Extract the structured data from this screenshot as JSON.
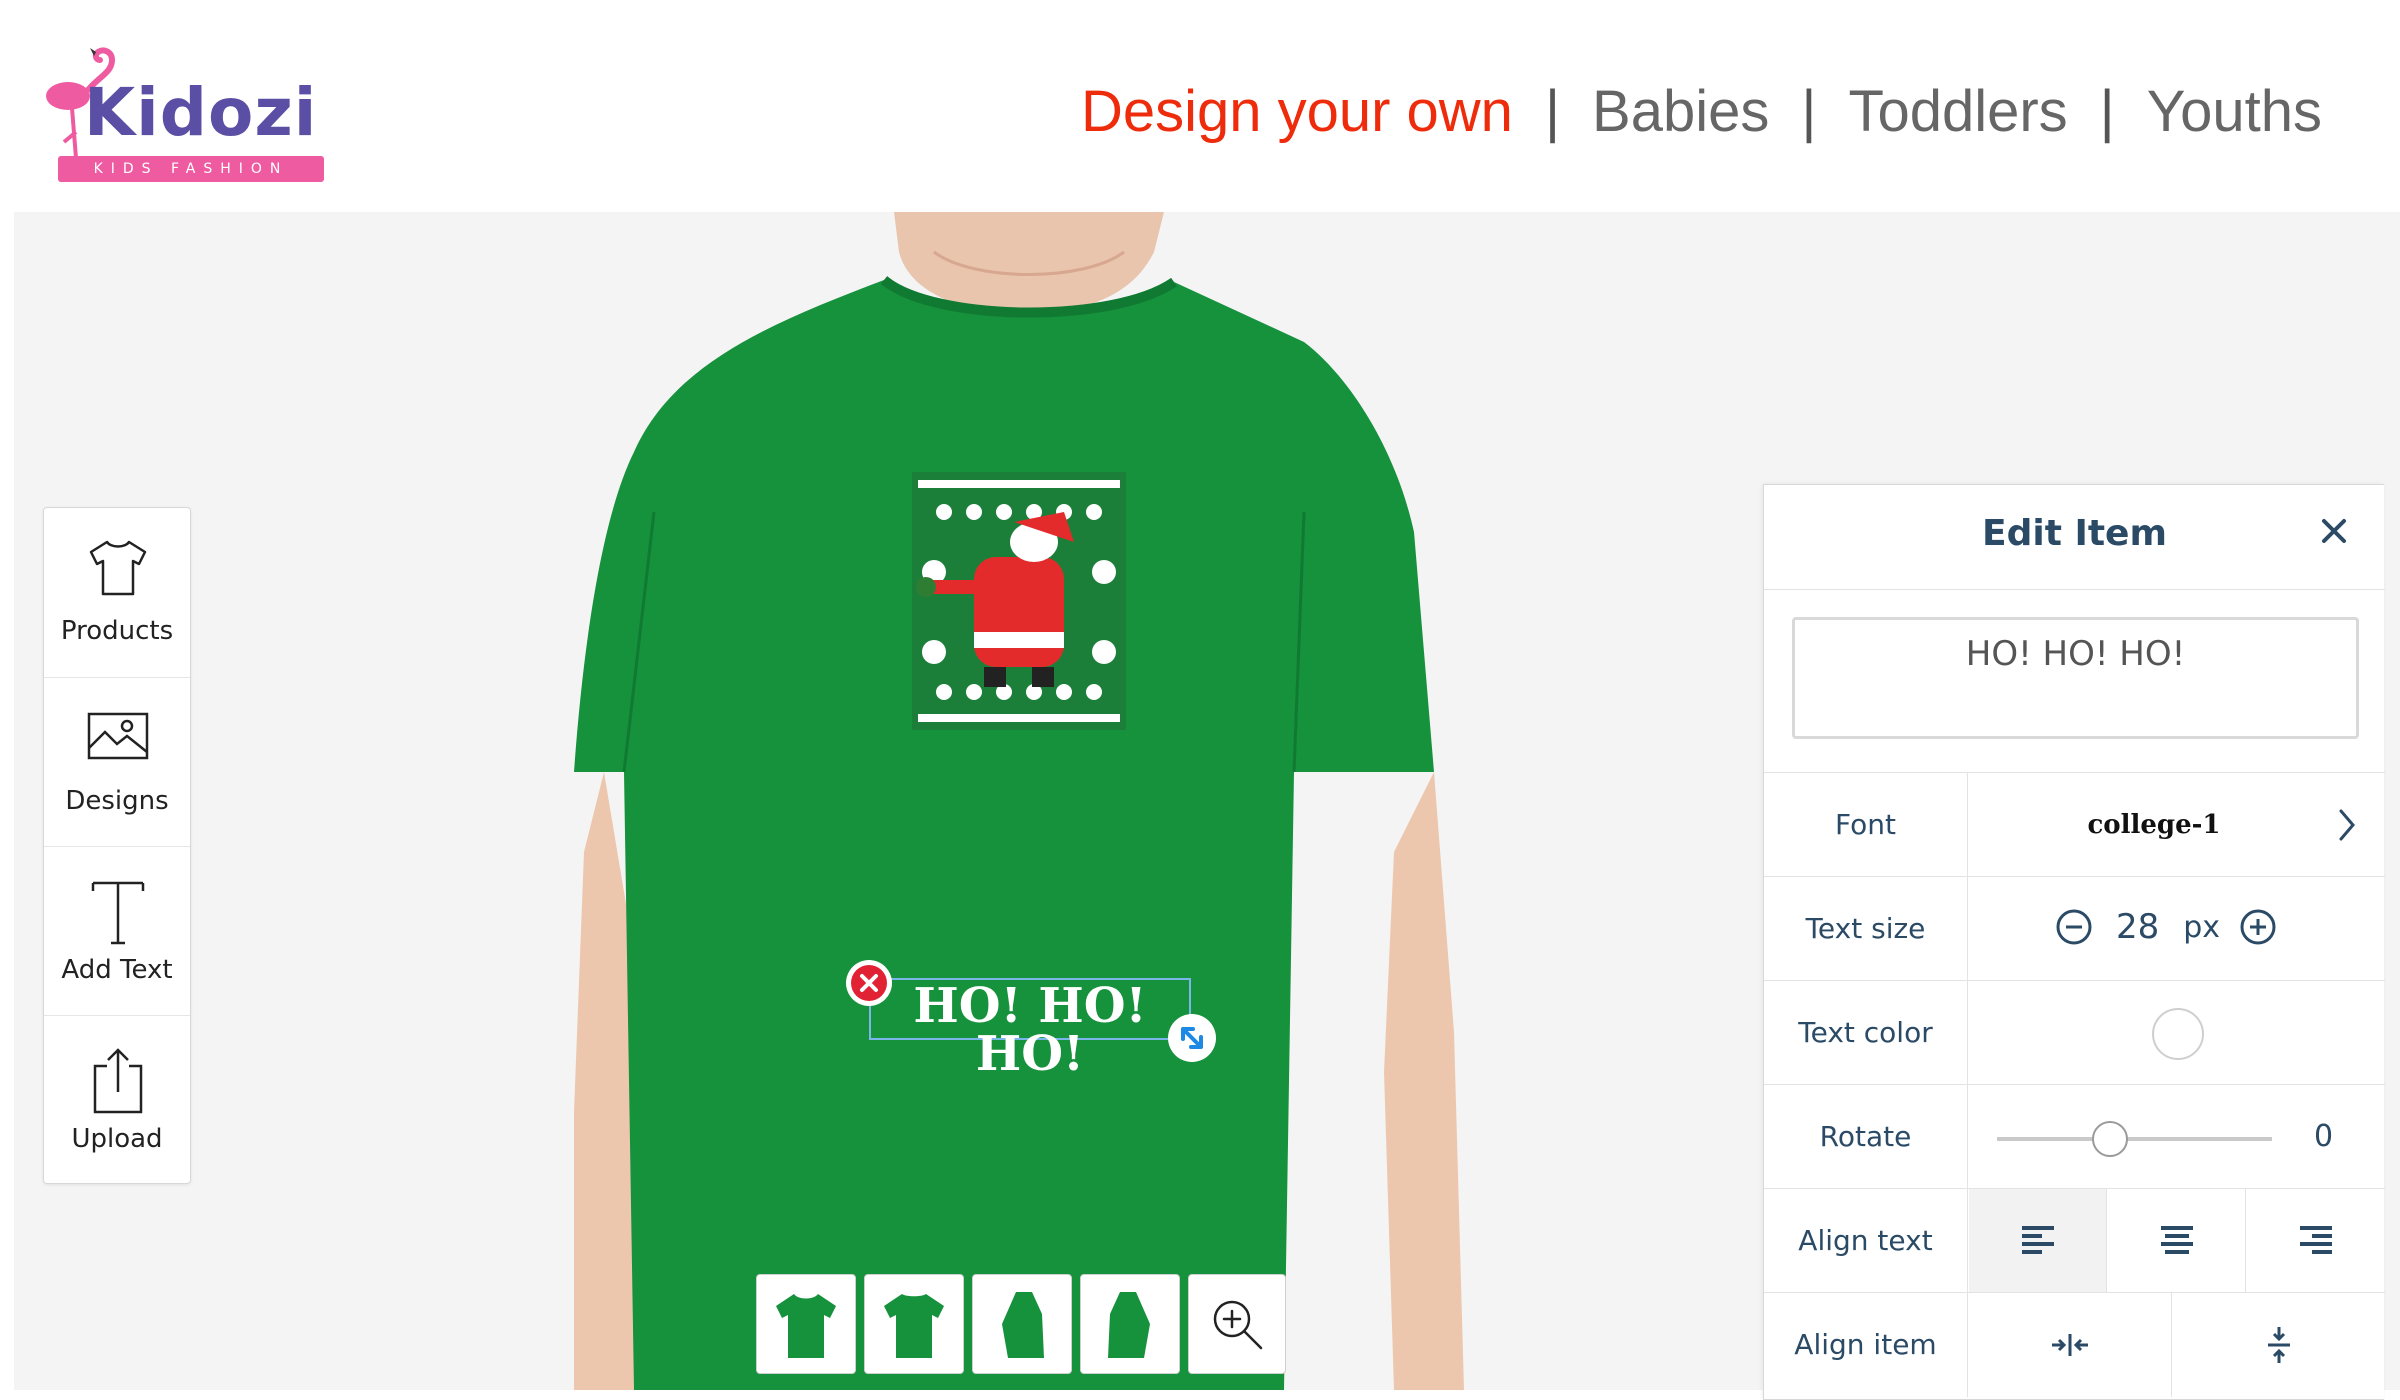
{
  "brand": {
    "name": "Kidozi",
    "tagline": "KIDS FASHION",
    "colors": {
      "purple": "#5b4ea5",
      "pink": "#ef5ba1"
    }
  },
  "nav": {
    "items": [
      {
        "label": "Design your own",
        "active": true
      },
      {
        "label": "Babies",
        "active": false
      },
      {
        "label": "Toddlers",
        "active": false
      },
      {
        "label": "Youths",
        "active": false
      }
    ],
    "separator": "|",
    "active_color": "#ee2b0b"
  },
  "toolbar": {
    "items": [
      {
        "label": "Products",
        "icon": "tshirt-icon"
      },
      {
        "label": "Designs",
        "icon": "image-icon"
      },
      {
        "label": "Add Text",
        "icon": "text-icon"
      },
      {
        "label": "Upload",
        "icon": "upload-icon"
      }
    ]
  },
  "canvas": {
    "shirt_color": "#16913c",
    "text_element": "HO! HO! HO!"
  },
  "thumbnails": {
    "count": 4,
    "icons": [
      "front-view",
      "back-view",
      "left-side-view",
      "right-side-view"
    ],
    "zoom_icon": "zoom-in-icon"
  },
  "edit_panel": {
    "title": "Edit Item",
    "text_value": "HO! HO! HO!",
    "font": {
      "label": "Font",
      "value": "college-1"
    },
    "text_size": {
      "label": "Text size",
      "value": "28",
      "unit": "px"
    },
    "text_color": {
      "label": "Text color",
      "value": "#ffffff"
    },
    "rotate": {
      "label": "Rotate",
      "value": "0"
    },
    "align_text": {
      "label": "Align text",
      "options": [
        "left",
        "center",
        "right"
      ],
      "selected": "left"
    },
    "align_item": {
      "label": "Align item",
      "options": [
        "horizontal-center",
        "vertical-center"
      ]
    }
  }
}
